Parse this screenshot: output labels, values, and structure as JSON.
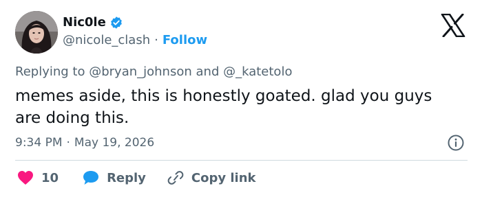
{
  "author": {
    "display_name": "Nic0le",
    "handle": "@nicole_clash",
    "separator": "·",
    "follow_label": "Follow",
    "verified_color": "#1d9bf0"
  },
  "reply_context": {
    "prefix": "Replying to",
    "mention1": "@bryan_johnson",
    "conjunction": "and",
    "mention2": "@_katetolo"
  },
  "tweet": {
    "text": "memes aside, this is honestly goated. glad you guys are doing this.",
    "time": "9:34 PM",
    "separator": "·",
    "date": "May 19, 2026"
  },
  "actions": {
    "likes_count": "10",
    "reply_label": "Reply",
    "copy_link_label": "Copy link"
  },
  "icons": {
    "logo": "x-logo-icon",
    "verified": "verified-badge-icon",
    "info": "info-icon",
    "like": "heart-icon",
    "reply": "speech-bubble-icon",
    "copy": "link-icon"
  },
  "colors": {
    "accent": "#1d9bf0",
    "like": "#f91880",
    "text": "#0f1419",
    "muted": "#536471"
  }
}
